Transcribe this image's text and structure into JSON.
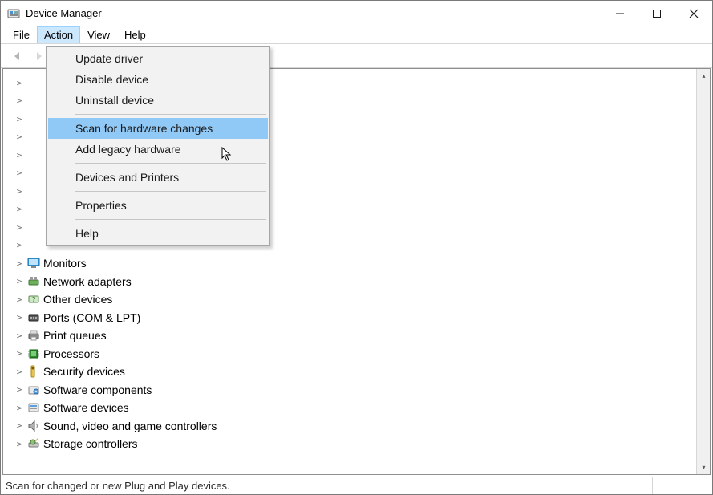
{
  "window": {
    "title": "Device Manager"
  },
  "menubar": [
    "File",
    "Action",
    "View",
    "Help"
  ],
  "menubar_open_index": 1,
  "dropdown": {
    "groups": [
      [
        "Update driver",
        "Disable device",
        "Uninstall device"
      ],
      [
        "Scan for hardware changes",
        "Add legacy hardware"
      ],
      [
        "Devices and Printers"
      ],
      [
        "Properties"
      ],
      [
        "Help"
      ]
    ],
    "highlighted": "Scan for hardware changes"
  },
  "tree": [
    {
      "label": "",
      "icon": "blank"
    },
    {
      "label": "",
      "icon": "blank"
    },
    {
      "label": "",
      "icon": "blank"
    },
    {
      "label": "",
      "icon": "blank"
    },
    {
      "label": "",
      "icon": "blank"
    },
    {
      "label": "",
      "icon": "blank"
    },
    {
      "label": "",
      "icon": "blank"
    },
    {
      "label": "",
      "icon": "blank"
    },
    {
      "label": "",
      "icon": "blank"
    },
    {
      "label": "",
      "icon": "blank"
    },
    {
      "label": "Monitors",
      "icon": "monitor"
    },
    {
      "label": "Network adapters",
      "icon": "network"
    },
    {
      "label": "Other devices",
      "icon": "other"
    },
    {
      "label": "Ports (COM & LPT)",
      "icon": "port"
    },
    {
      "label": "Print queues",
      "icon": "printer"
    },
    {
      "label": "Processors",
      "icon": "cpu"
    },
    {
      "label": "Security devices",
      "icon": "security"
    },
    {
      "label": "Software components",
      "icon": "swcomp"
    },
    {
      "label": "Software devices",
      "icon": "swdev"
    },
    {
      "label": "Sound, video and game controllers",
      "icon": "sound"
    },
    {
      "label": "Storage controllers",
      "icon": "storage"
    }
  ],
  "statusbar": {
    "text": "Scan for changed or new Plug and Play devices."
  }
}
